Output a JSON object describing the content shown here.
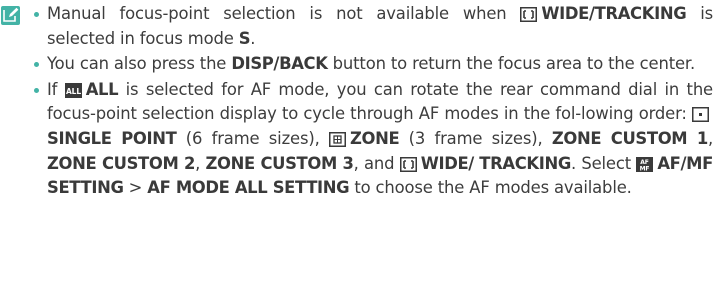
{
  "accent_color": "#43b3a6",
  "note_icon": "note-pencil-icon",
  "bullets": [
    {
      "parts": [
        "Manual focus-point selection is not available when ",
        "WIDE/TRACKING",
        " is selected in focus mode ",
        "S",
        "."
      ]
    },
    {
      "parts": [
        "You can also press the ",
        "DISP/BACK",
        " button to return the focus area to the center."
      ]
    },
    {
      "parts": [
        "If ",
        "ALL",
        " is selected for AF mode, you can rotate the rear command dial in the focus-point selection display to cycle through AF modes in the fol-lowing order: ",
        "SINGLE POINT",
        " (6 frame sizes), ",
        "ZONE",
        " (3 frame sizes), ",
        "ZONE CUSTOM 1",
        ", ",
        "ZONE CUSTOM 2",
        ", ",
        "ZONE CUSTOM 3",
        ", and ",
        "WIDE/",
        " ",
        "TRACKING",
        ". Select ",
        "AF/MF SETTING",
        " > ",
        "AF MODE ALL SETTING",
        " to choose the AF modes available."
      ]
    }
  ],
  "icons": {
    "wide_tracking": "wide-tracking-icon",
    "all": "af-all-icon",
    "single_point": "single-point-icon",
    "zone": "zone-icon",
    "af_mf": "af-mf-menu-icon"
  }
}
